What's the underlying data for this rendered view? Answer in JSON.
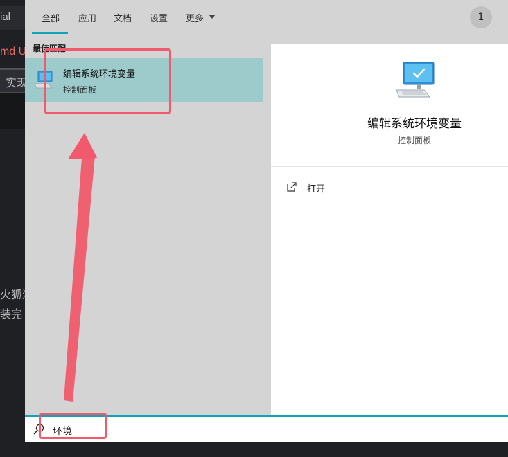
{
  "background": {
    "tab_fragment": "ial",
    "cmd_fragment": "md U",
    "shi_fragment": "实现",
    "line1_fragment": "火狐浏",
    "line2_fragment": "装完"
  },
  "tabs": [
    {
      "label": "全部",
      "active": true
    },
    {
      "label": "应用"
    },
    {
      "label": "文档"
    },
    {
      "label": "设置"
    },
    {
      "label": "更多"
    }
  ],
  "user": {
    "avatar_initial": "1"
  },
  "best_match": {
    "section_title": "最佳匹配",
    "title": "编辑系统环境变量",
    "subtitle": "控制面板",
    "icon": "monitor-check-icon"
  },
  "detail": {
    "title": "编辑系统环境变量",
    "subtitle": "控制面板",
    "icon": "monitor-check-icon",
    "actions": [
      {
        "label": "打开",
        "icon": "open-icon"
      }
    ]
  },
  "search": {
    "value": "环境",
    "icon": "search-icon"
  },
  "colors": {
    "accent": "#11a3b8",
    "highlight": "#9dcacb",
    "annotation": "#f05a6c"
  }
}
